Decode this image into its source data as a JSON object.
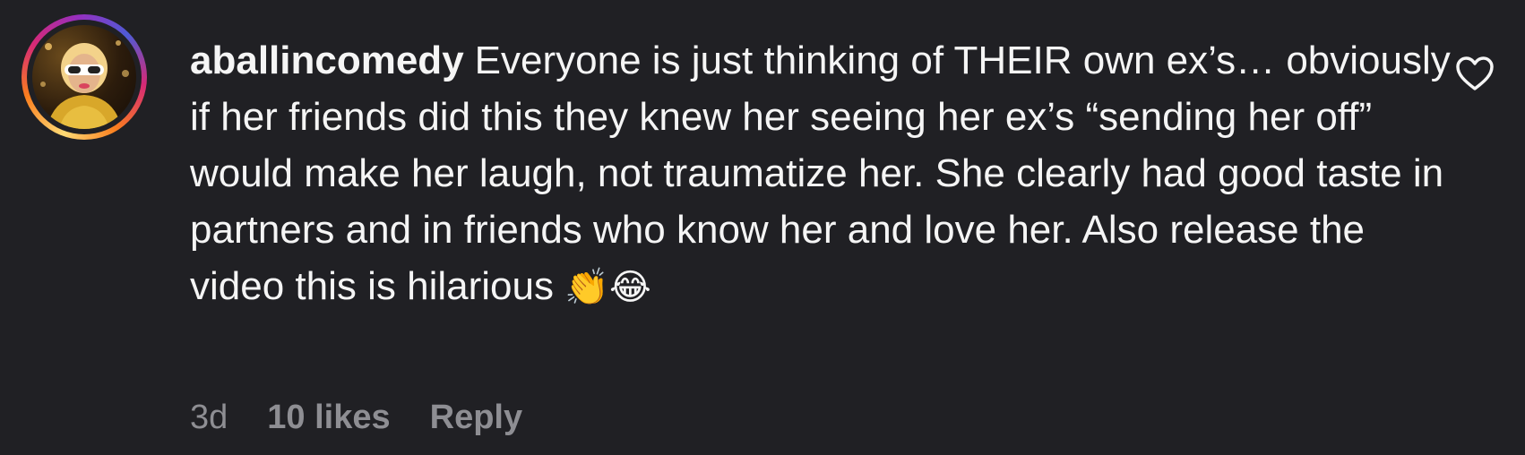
{
  "comment": {
    "username": "aballincomedy",
    "text": "Everyone is just thinking of THEIR own ex’s… obviously if her friends did this they knew her seeing her ex’s “sending her off” would make her laugh, not traumatize her. She clearly had good taste in partners and in friends who know her and love her. Also release the video this is hilarious",
    "emojis": [
      "👏",
      "😂"
    ],
    "time_ago": "3d",
    "likes_label": "10 likes",
    "reply_label": "Reply",
    "like_icon": "heart-outline-icon",
    "avatar_icon": "profile-photo"
  },
  "colors": {
    "background": "#202024",
    "text": "#f5f5f5",
    "meta": "#8e8e93",
    "ring_gradient": [
      "#feda75",
      "#fa7e1e",
      "#d62976",
      "#962fbf",
      "#4f5bd5"
    ]
  }
}
